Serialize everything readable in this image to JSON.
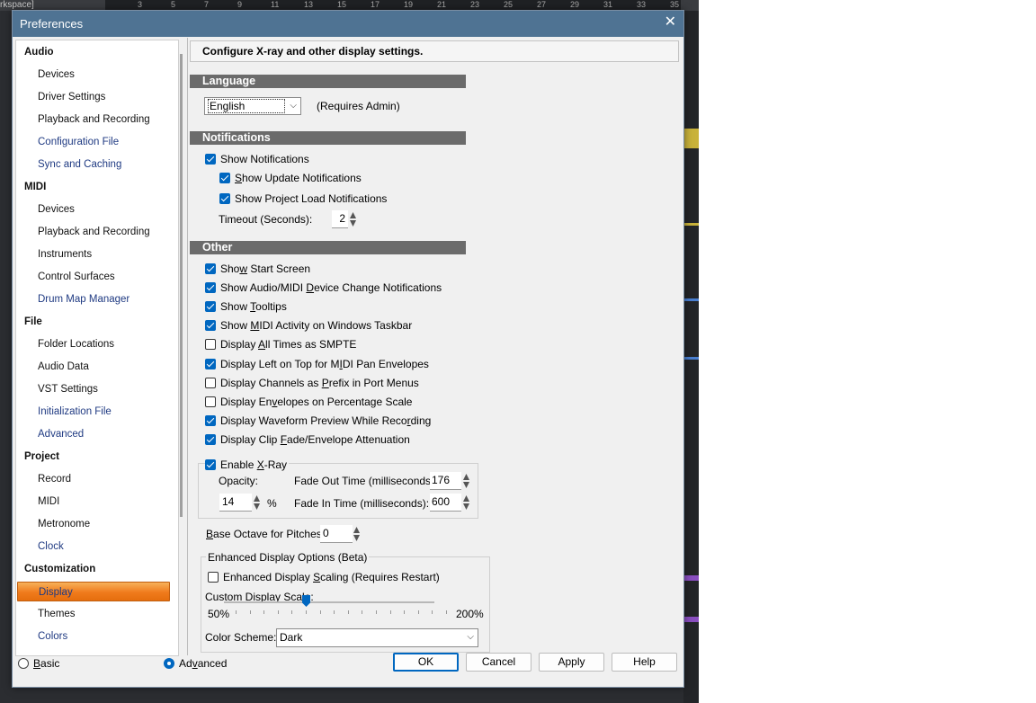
{
  "background": {
    "workspace_label": "rkspace]",
    "ruler_ticks": [
      "3",
      "5",
      "7",
      "9",
      "11",
      "13",
      "15",
      "17",
      "19",
      "21",
      "23",
      "25",
      "27",
      "29",
      "31",
      "33",
      "35"
    ]
  },
  "dialog": {
    "title": "Preferences",
    "close_glyph": "✕",
    "header": "Configure X-ray and other display settings."
  },
  "nav": [
    {
      "label": "Audio",
      "kind": "cat"
    },
    {
      "label": "Devices",
      "kind": "sub"
    },
    {
      "label": "Driver Settings",
      "kind": "sub"
    },
    {
      "label": "Playback and Recording",
      "kind": "sub"
    },
    {
      "label": "Configuration File",
      "kind": "link"
    },
    {
      "label": "Sync and Caching",
      "kind": "link"
    },
    {
      "label": "MIDI",
      "kind": "cat"
    },
    {
      "label": "Devices",
      "kind": "sub"
    },
    {
      "label": "Playback and Recording",
      "kind": "sub"
    },
    {
      "label": "Instruments",
      "kind": "sub"
    },
    {
      "label": "Control Surfaces",
      "kind": "sub"
    },
    {
      "label": "Drum Map Manager",
      "kind": "link"
    },
    {
      "label": "File",
      "kind": "cat"
    },
    {
      "label": "Folder Locations",
      "kind": "sub"
    },
    {
      "label": "Audio Data",
      "kind": "sub"
    },
    {
      "label": "VST Settings",
      "kind": "sub"
    },
    {
      "label": "Initialization File",
      "kind": "link"
    },
    {
      "label": "Advanced",
      "kind": "link"
    },
    {
      "label": "Project",
      "kind": "cat"
    },
    {
      "label": "Record",
      "kind": "sub"
    },
    {
      "label": "MIDI",
      "kind": "sub"
    },
    {
      "label": "Metronome",
      "kind": "sub"
    },
    {
      "label": "Clock",
      "kind": "link"
    },
    {
      "label": "Customization",
      "kind": "cat"
    },
    {
      "label": "Display",
      "kind": "sel"
    },
    {
      "label": "Themes",
      "kind": "sub"
    },
    {
      "label": "Colors",
      "kind": "link"
    }
  ],
  "language": {
    "band": "Language",
    "value": "English",
    "note": "(Requires Admin)"
  },
  "notifications": {
    "band": "Notifications",
    "show_notifications": {
      "label": "Show Notifications",
      "checked": true
    },
    "show_update": {
      "label_pre": "",
      "key": "S",
      "label_post": "how Update Notifications",
      "checked": true
    },
    "show_project_load": {
      "label": "Show Project Load Notifications",
      "checked": true
    },
    "timeout_label": "Timeout (Seconds):",
    "timeout_value": "2"
  },
  "other": {
    "band": "Other",
    "options": [
      {
        "pre": "Sho",
        "key": "w",
        "post": " Start Screen",
        "checked": true
      },
      {
        "pre": "Show Audio/MIDI ",
        "key": "D",
        "post": "evice Change Notifications",
        "checked": true
      },
      {
        "pre": "Show ",
        "key": "T",
        "post": "ooltips",
        "checked": true
      },
      {
        "pre": "Show ",
        "key": "M",
        "post": "IDI Activity on Windows Taskbar",
        "checked": true
      },
      {
        "pre": "Display ",
        "key": "A",
        "post": "ll Times as SMPTE",
        "checked": false
      },
      {
        "pre": "Display Left on Top for M",
        "key": "I",
        "post": "DI Pan Envelopes",
        "checked": true
      },
      {
        "pre": "Display Channels as ",
        "key": "P",
        "post": "refix in Port Menus",
        "checked": false
      },
      {
        "pre": "Display En",
        "key": "v",
        "post": "elopes on Percentage Scale",
        "checked": false
      },
      {
        "pre": "Display Waveform Preview While Reco",
        "key": "r",
        "post": "ding",
        "checked": true
      },
      {
        "pre": "Display Clip ",
        "key": "F",
        "post": "ade/Envelope Attenuation",
        "checked": true
      }
    ]
  },
  "xray": {
    "enable": {
      "pre": "Enable ",
      "key": "X",
      "post": "-Ray",
      "checked": true
    },
    "opacity_label": "Opacity:",
    "opacity_value": "14",
    "percent": "%",
    "fade_out_label": "Fade Out Time (milliseconds):",
    "fade_out_value": "176",
    "fade_in_label": "Fade In Time (milliseconds):",
    "fade_in_value": "600"
  },
  "base_octave": {
    "key": "B",
    "post": "ase Octave for Pitches:",
    "value": "0"
  },
  "enhanced": {
    "group_label": "Enhanced Display Options (Beta)",
    "scaling": {
      "pre": "Enhanced Display ",
      "key": "S",
      "post": "caling (Requires Restart)",
      "checked": false
    },
    "custom_scale_label": "Custom Display Scale:",
    "min_label": "50%",
    "max_label": "200%",
    "scale_percent": 100,
    "color_scheme_label": "Color Scheme:",
    "color_scheme_value": "Dark"
  },
  "footer": {
    "basic": {
      "key": "B",
      "post": "asic",
      "selected": false
    },
    "advanced": {
      "pre": "Ad",
      "key": "v",
      "post": "anced",
      "selected": true
    },
    "ok": "OK",
    "cancel": "Cancel",
    "apply": "Apply",
    "help": "Help"
  },
  "colors": {
    "titlebar": "#4f7393",
    "accent": "#0067c0",
    "selected_nav": "#f07b1c"
  }
}
